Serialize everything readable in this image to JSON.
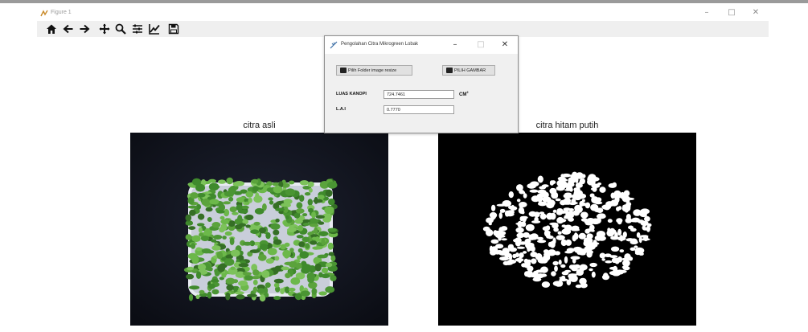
{
  "figure": {
    "title": "Figure 1",
    "window_buttons": [
      "–",
      "□",
      "✕"
    ],
    "toolbar": [
      {
        "name": "home-icon",
        "glyph": "home"
      },
      {
        "name": "back-arrow-icon",
        "glyph": "back"
      },
      {
        "name": "forward-arrow-icon",
        "glyph": "forward"
      },
      {
        "name": "pan-icon",
        "glyph": "move"
      },
      {
        "name": "zoom-icon",
        "glyph": "zoom"
      },
      {
        "name": "subplots-config-icon",
        "glyph": "sliders"
      },
      {
        "name": "edit-axes-icon",
        "glyph": "chart"
      },
      {
        "name": "save-icon",
        "glyph": "save"
      }
    ]
  },
  "plots": {
    "left_title": "citra asli",
    "right_title": "citra hitam putih"
  },
  "dialog": {
    "title": "Pengolahan Citra Mikrogreen Lobak",
    "window_buttons": [
      "–",
      "□",
      "✕"
    ],
    "folder_button": "Pilih Folder image resize",
    "pick_button": "PILIH GAMBAR",
    "luas_label": "LUAS KANOPI",
    "luas_value": "724.7461",
    "luas_unit": "CM",
    "luas_unit_sup": "2",
    "lai_label": "L.A.I",
    "lai_value": "0.7770"
  },
  "colors": {
    "toolbar_bg": "#efefef",
    "dialog_bg": "#f0f0f0",
    "plant_green": "#5ba33c",
    "tray": "#d8dce8"
  }
}
